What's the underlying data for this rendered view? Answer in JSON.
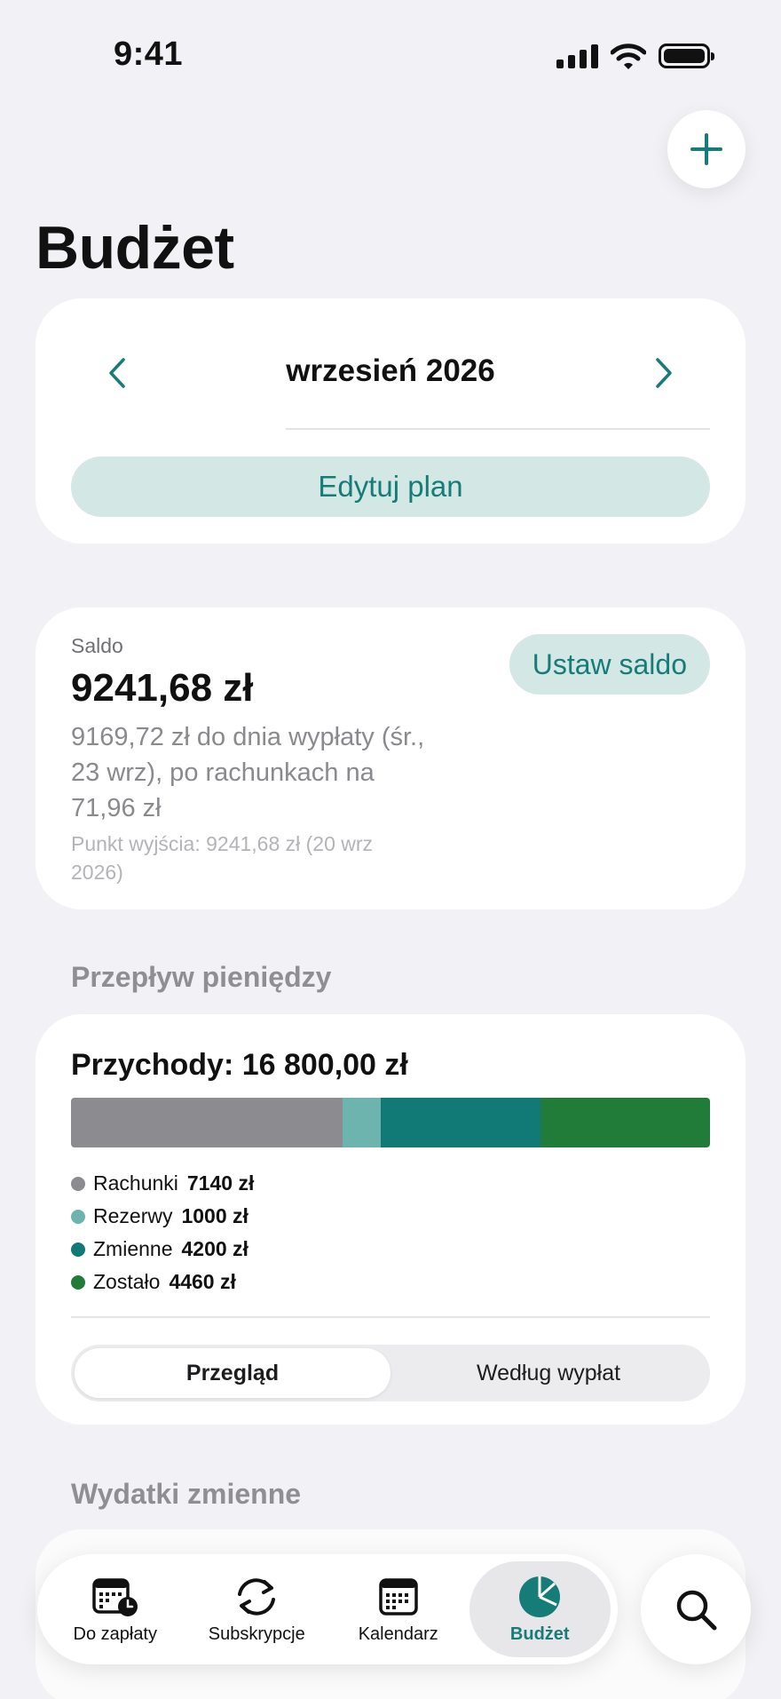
{
  "status_bar": {
    "time": "9:41"
  },
  "header": {
    "title": "Budżet"
  },
  "month_nav": {
    "label": "wrzesień 2026",
    "edit_plan_label": "Edytuj plan"
  },
  "balance": {
    "label": "Saldo",
    "value": "9241,68 zł",
    "description": "9169,72 zł do dnia wypłaty (śr., 23 wrz), po rachunkach na 71,96 zł",
    "origin": "Punkt wyjścia: 9241,68 zł (20 wrz 2026)",
    "set_balance_label": "Ustaw saldo"
  },
  "cash_flow": {
    "section_title": "Przepływ pieniędzy",
    "title": "Przychody: 16 800,00 zł",
    "items": [
      {
        "label": "Rachunki",
        "amount": "7140 zł",
        "value": 7140,
        "color": "#8b8b90"
      },
      {
        "label": "Rezerwy",
        "amount": "1000 zł",
        "value": 1000,
        "color": "#6db3ae"
      },
      {
        "label": "Zmienne",
        "amount": "4200 zł",
        "value": 4200,
        "color": "#117a76"
      },
      {
        "label": "Zostało",
        "amount": "4460 zł",
        "value": 4460,
        "color": "#217b39"
      }
    ],
    "tabs": [
      {
        "label": "Przegląd",
        "active": true
      },
      {
        "label": "Według wypłat",
        "active": false
      }
    ]
  },
  "variable_expenses": {
    "section_title": "Wydatki zmienne"
  },
  "tab_bar": {
    "items": [
      {
        "label": "Do zapłaty",
        "icon": "calendar-clock-icon",
        "active": false
      },
      {
        "label": "Subskrypcje",
        "icon": "refresh-icon",
        "active": false
      },
      {
        "label": "Kalendarz",
        "icon": "calendar-icon",
        "active": false
      },
      {
        "label": "Budżet",
        "icon": "pie-chart-icon",
        "active": true
      }
    ],
    "search_icon": "search-icon"
  },
  "colors": {
    "accent": "#167c77",
    "accent_bg": "#d3e7e5",
    "background": "#f2f2f6"
  }
}
